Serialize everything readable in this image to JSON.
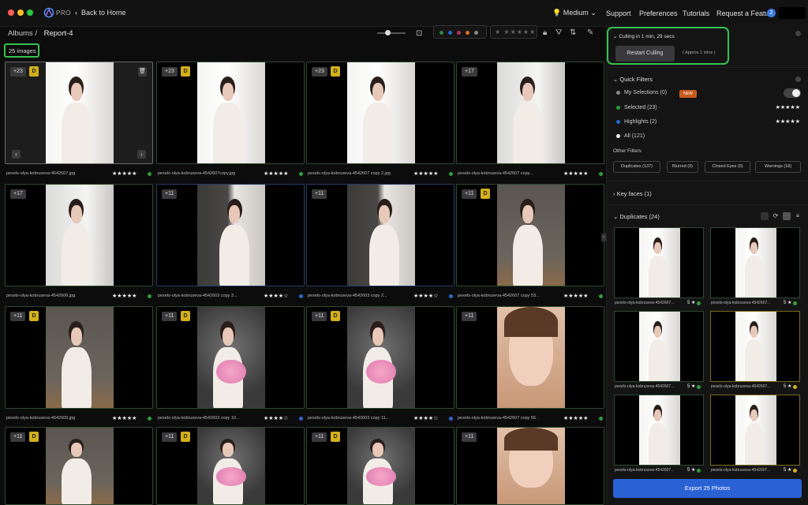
{
  "titlebar": {
    "pro_label": "PRO",
    "back_label": "Back to Home",
    "quality_label": "Medium",
    "menu": [
      "Support",
      "Preferences",
      "Tutorials",
      "Request a Feature"
    ],
    "avatar_letter": "2",
    "traffic_colors": [
      "#ff5f57",
      "#febc2e",
      "#28c840"
    ]
  },
  "breadcrumb": {
    "root": "Albums /",
    "current": "Report-4"
  },
  "image_count": "25 images",
  "filter_colors": [
    "#2a8c3a",
    "#2a6ad0",
    "#b03060",
    "#e07020",
    "#888888"
  ],
  "star_filter": "★ ★★★★★",
  "grid": [
    {
      "badge": "+23",
      "d": true,
      "photo": "window-a",
      "caption": "pexels-olya-kobruseva-4542607.jpg",
      "stars": "★★★★★",
      "dot": "#2e9e3a",
      "style": "sel",
      "nav": true
    },
    {
      "badge": "+23",
      "d": true,
      "photo": "window-a",
      "caption": "pexels-olya-kobruseva-4542607copy.jpg",
      "stars": "★★★★★",
      "dot": "#2e9e3a",
      "style": "normal"
    },
    {
      "badge": "+23",
      "d": true,
      "photo": "window-a",
      "caption": "pexels-olya-kobruseva-4542607 copy 2.jpg",
      "stars": "★★★★★",
      "dot": "#2e9e3a",
      "style": "normal"
    },
    {
      "badge": "+17",
      "d": false,
      "photo": "window-b",
      "caption": "pexels-olya-kobruseva-4542607 copy...",
      "stars": "★★★★★",
      "dot": "#2e9e3a",
      "style": "normal"
    },
    {
      "badge": "+17",
      "d": false,
      "photo": "window-b",
      "caption": "pexels-olya-kobruseva-4542606.jpg",
      "stars": "★★★★★",
      "dot": "#2e9e3a",
      "style": "normal"
    },
    {
      "badge": "+11",
      "d": false,
      "photo": "curtain",
      "caption": "pexels-olya-kobruseva-4542603 copy 3...",
      "stars": "★★★★☆",
      "dot": "#2a6ad0",
      "style": "blue"
    },
    {
      "badge": "+11",
      "d": false,
      "photo": "curtain",
      "caption": "pexels-olya-kobruseva-4542603 copy 2...",
      "stars": "★★★★☆",
      "dot": "#2a6ad0",
      "style": "blue"
    },
    {
      "badge": "+11",
      "d": true,
      "photo": "seated",
      "caption": "pexels-olya-kobruseva-4542607 copy 53...",
      "stars": "★★★★★",
      "dot": "#2e9e3a",
      "style": "normal"
    },
    {
      "badge": "+11",
      "d": true,
      "photo": "seated",
      "caption": "pexels-olya-kobruseva-4542605.jpg",
      "stars": "★★★★★",
      "dot": "#2e9e3a",
      "style": "normal"
    },
    {
      "badge": "+11",
      "d": true,
      "photo": "flowers",
      "caption": "pexels-olya-kobruseva-4542603 copy 10...",
      "stars": "★★★★☆",
      "dot": "#2a6ad0",
      "style": "normal"
    },
    {
      "badge": "+11",
      "d": true,
      "photo": "flowers",
      "caption": "pexels-olya-kobruseva-4542603 copy 11...",
      "stars": "★★★★☆",
      "dot": "#2a6ad0",
      "style": "normal"
    },
    {
      "badge": "+11",
      "d": false,
      "photo": "face",
      "caption": "pexels-olya-kobruseva-4542607 copy 56 .",
      "stars": "★★★★★",
      "dot": "#2e9e3a",
      "style": "normal"
    },
    {
      "badge": "+11",
      "d": true,
      "photo": "seated",
      "caption": "",
      "stars": "",
      "dot": "",
      "style": "normal"
    },
    {
      "badge": "+11",
      "d": true,
      "photo": "flowers",
      "caption": "",
      "stars": "",
      "dot": "",
      "style": "normal"
    },
    {
      "badge": "+11",
      "d": true,
      "photo": "flowers",
      "caption": "",
      "stars": "",
      "dot": "",
      "style": "normal"
    },
    {
      "badge": "+11",
      "d": false,
      "photo": "face",
      "caption": "",
      "stars": "",
      "dot": "",
      "style": "normal"
    }
  ],
  "panel": {
    "culling_title": "Culling in 1 min, 29 secs",
    "restart_label": "Restart Culling",
    "approx_label": "( Approx 1 mins )",
    "quick_filters_title": "Quick Filters",
    "quick_filters": [
      {
        "label": "My Selections (0)",
        "color": "#888888",
        "stars": ""
      },
      {
        "label": "Selected (23) ·",
        "color": "#2e9e3a",
        "stars": "★★★★★"
      },
      {
        "label": "Highlights (2)",
        "color": "#2a6ad0",
        "stars": "★★★★★"
      },
      {
        "label": "All (121)",
        "color": "#eeeeee",
        "stars": ""
      }
    ],
    "new_tag": "NEW",
    "other_filters_title": "Other Filters",
    "other_filters": [
      "Duplicates (137)",
      "Blurred (0)",
      "Closed Eyes (0)",
      "Warnings (18)"
    ],
    "key_faces": "Key faces (1)",
    "duplicates_title": "Duplicates (24)",
    "duplicates": [
      {
        "caption": "pexels-olya-kobruseva-4542607...",
        "rating": "5 ★",
        "dot": "#2e9e3a",
        "style": "normal"
      },
      {
        "caption": "pexels-olya-kobruseva-4542607...",
        "rating": "5 ★",
        "dot": "#2e9e3a",
        "style": "normal"
      },
      {
        "caption": "pexels-olya-kobruseva-4542607...",
        "rating": "5 ★",
        "dot": "#2e9e3a",
        "style": "normal"
      },
      {
        "caption": "pexels-olya-kobruseva-4542607...",
        "rating": "5 ★",
        "dot": "#d3b01a",
        "style": "ylw"
      },
      {
        "caption": "pexels-olya-kobruseva-4542607...",
        "rating": "5 ★",
        "dot": "#2e9e3a",
        "style": "normal"
      },
      {
        "caption": "pexels-olya-kobruseva-4542607...",
        "rating": "5 ★",
        "dot": "#d3b01a",
        "style": "ylw"
      }
    ],
    "export_label": "Export 25 Photos"
  }
}
